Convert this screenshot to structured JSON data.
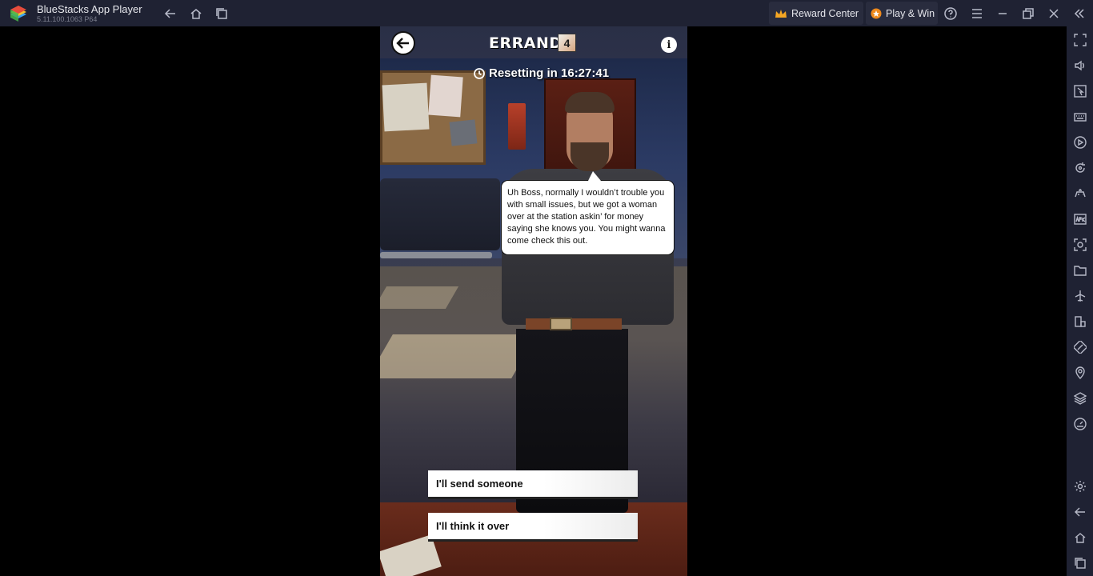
{
  "window": {
    "app_name": "BlueStacks App Player",
    "app_version": "5.11.100.1063  P64",
    "reward_center_label": "Reward Center",
    "play_win_label": "Play & Win"
  },
  "game": {
    "title": "ERRANDS",
    "errand_count": "4",
    "reset_text": "Resetting in 16:27:41",
    "dialogue": "Uh Boss, normally I wouldn’t trouble you with small issues, but we got a woman over at the station askin’ for money saying she knows you. You might wanna come check this out.",
    "choices": [
      {
        "label": "I'll send someone"
      },
      {
        "label": "I'll think it over"
      }
    ]
  },
  "sidebar_icons": [
    "fullscreen-icon",
    "volume-icon",
    "pointer-icon",
    "keyboard-icon",
    "macro-icon",
    "rotate-icon",
    "gamepad-icon",
    "apk-icon",
    "screenshot-icon",
    "folder-icon",
    "airplane-icon",
    "multi-instance-icon",
    "eco-mode-icon",
    "location-icon",
    "layers-icon",
    "speed-icon",
    "settings-icon",
    "back-icon",
    "home-icon",
    "recents-icon"
  ],
  "colors": {
    "chrome": "#1f2233",
    "button_bg": "#292c3e",
    "accent_orange": "#f08a1c"
  }
}
